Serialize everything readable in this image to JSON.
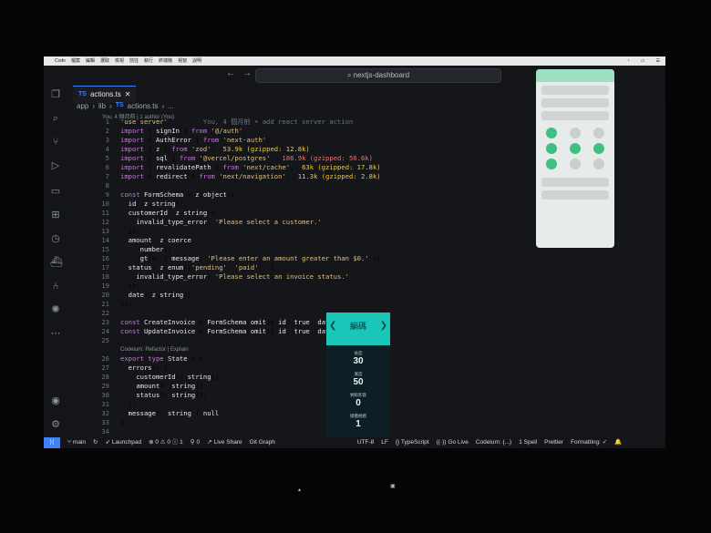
{
  "app": {
    "command_center": "nextjs-dashboard"
  },
  "menubar": {
    "items": [
      "Code",
      "檔案",
      "編輯",
      "選取",
      "檢視",
      "前往",
      "執行",
      "終端機",
      "視窗",
      "說明"
    ]
  },
  "tab": {
    "lang": "TS",
    "name": "actions.ts"
  },
  "breadcrumb": {
    "parts": [
      "app",
      "lib",
      "TS",
      "actions.ts",
      "..."
    ]
  },
  "blame_header": "You, 4 個月前 | 1 author (You)",
  "codelens": "Codeium: Refactor | Explain",
  "inline_blame": "You, 4 個月前 • add react server action",
  "code": [
    {
      "n": "1",
      "t": "'use server';"
    },
    {
      "n": "2",
      "t": "import { signIn } from '@/auth';"
    },
    {
      "n": "3",
      "t": "import { AuthError } from 'next-auth';"
    },
    {
      "n": "4",
      "t": "import { z } from 'zod';",
      "size": "53.9k (gzipped: 12.8k)"
    },
    {
      "n": "5",
      "t": "import { sql } from '@vercel/postgres';",
      "size": "186.9k (gzipped: 56.6k)"
    },
    {
      "n": "6",
      "t": "import { revalidatePath } from 'next/cache';",
      "size": "63k (gzipped: 17.8k)"
    },
    {
      "n": "7",
      "t": "import { redirect } from 'next/navigation';",
      "size": "11.3k (gzipped: 2.8k)"
    },
    {
      "n": "8",
      "t": ""
    },
    {
      "n": "9",
      "t": "const FormSchema = z.object({"
    },
    {
      "n": "10",
      "t": "  id: z.string(),"
    },
    {
      "n": "11",
      "t": "  customerId: z.string({"
    },
    {
      "n": "12",
      "t": "    invalid_type_error: 'Please select a customer.',"
    },
    {
      "n": "13",
      "t": "  }),"
    },
    {
      "n": "14",
      "t": "  amount: z.coerce"
    },
    {
      "n": "15",
      "t": "    .number()"
    },
    {
      "n": "16",
      "t": "    .gt(0, { message: 'Please enter an amount greater than $0.' }),"
    },
    {
      "n": "17",
      "t": "  status: z.enum(['pending', 'paid'], {"
    },
    {
      "n": "18",
      "t": "    invalid_type_error: 'Please select an invoice status.',"
    },
    {
      "n": "19",
      "t": "  }),"
    },
    {
      "n": "20",
      "t": "  date: z.string(),"
    },
    {
      "n": "21",
      "t": "});"
    },
    {
      "n": "22",
      "t": ""
    },
    {
      "n": "23",
      "t": "const CreateInvoice = FormSchema.omit({ id: true, date: true"
    },
    {
      "n": "24",
      "t": "const UpdateInvoice = FormSchema.omit({ id: true, date: true"
    },
    {
      "n": "25",
      "t": ""
    },
    {
      "n": "26",
      "t": "export type State = {"
    },
    {
      "n": "27",
      "t": "  errors?: {"
    },
    {
      "n": "28",
      "t": "    customerId?: string[];"
    },
    {
      "n": "29",
      "t": "    amount?: string[];"
    },
    {
      "n": "30",
      "t": "    status?: string[];"
    },
    {
      "n": "31",
      "t": "  };"
    },
    {
      "n": "32",
      "t": "  message?: string | null;"
    },
    {
      "n": "33",
      "t": "};"
    },
    {
      "n": "34",
      "t": ""
    }
  ],
  "widget": {
    "title": "編碼",
    "stats": [
      {
        "label": "長度",
        "value": "30"
      },
      {
        "label": "寬度",
        "value": "50"
      },
      {
        "label": "剩餘卸貨",
        "value": "0"
      },
      {
        "label": "總體規模",
        "value": "1"
      }
    ]
  },
  "statusbar": {
    "branch": "main",
    "launchpad": "Launchpad",
    "problems": "⊗ 0 ⚠ 0 ⓘ 1",
    "ports": "0",
    "live_share": "Live Share",
    "git_graph": "Git Graph",
    "encoding": "UTF-8",
    "eol": "LF",
    "language": "{} TypeScript",
    "go_live": "Go Live",
    "codeium": "Codeium: {...}",
    "spell": "1 Spell",
    "prettier": "Prettier",
    "formatting": "Formatting: ✓"
  }
}
